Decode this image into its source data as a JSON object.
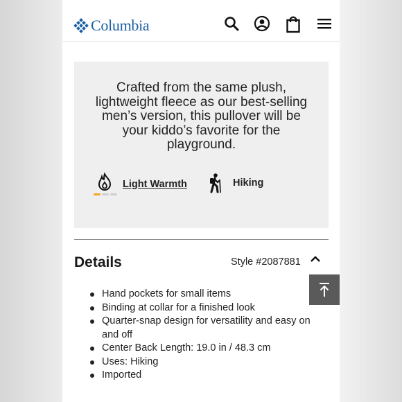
{
  "header": {
    "logo_text": "Columbia",
    "brand_color": "#1a5fa3",
    "icons": [
      "search-icon",
      "account-icon",
      "shopping-bag-icon",
      "menu-icon"
    ]
  },
  "promo": {
    "text": "Crafted from the same plush, lightweight fleece as our best-selling men’s version, this pullover will be your kiddo’s favorite for the playground.",
    "features": [
      {
        "icon": "flame-icon",
        "label": "Light Warmth",
        "link": true,
        "warmth_level": 1,
        "warmth_max": 3,
        "warmth_color": "#f5a623"
      },
      {
        "icon": "hiker-icon",
        "label": "Hiking",
        "link": false
      }
    ]
  },
  "details": {
    "title": "Details",
    "style_number": "Style #2087881",
    "expanded": true,
    "bullets": [
      "Hand pockets for small items",
      "Binding at collar for a finished look",
      "Quarter-snap design for versatility and easy on and off",
      "Center Back Length: 19.0 in / 48.3 cm",
      "Uses: Hiking",
      "Imported"
    ]
  },
  "scroll_top_icon": "arrow-up-to-top-icon"
}
